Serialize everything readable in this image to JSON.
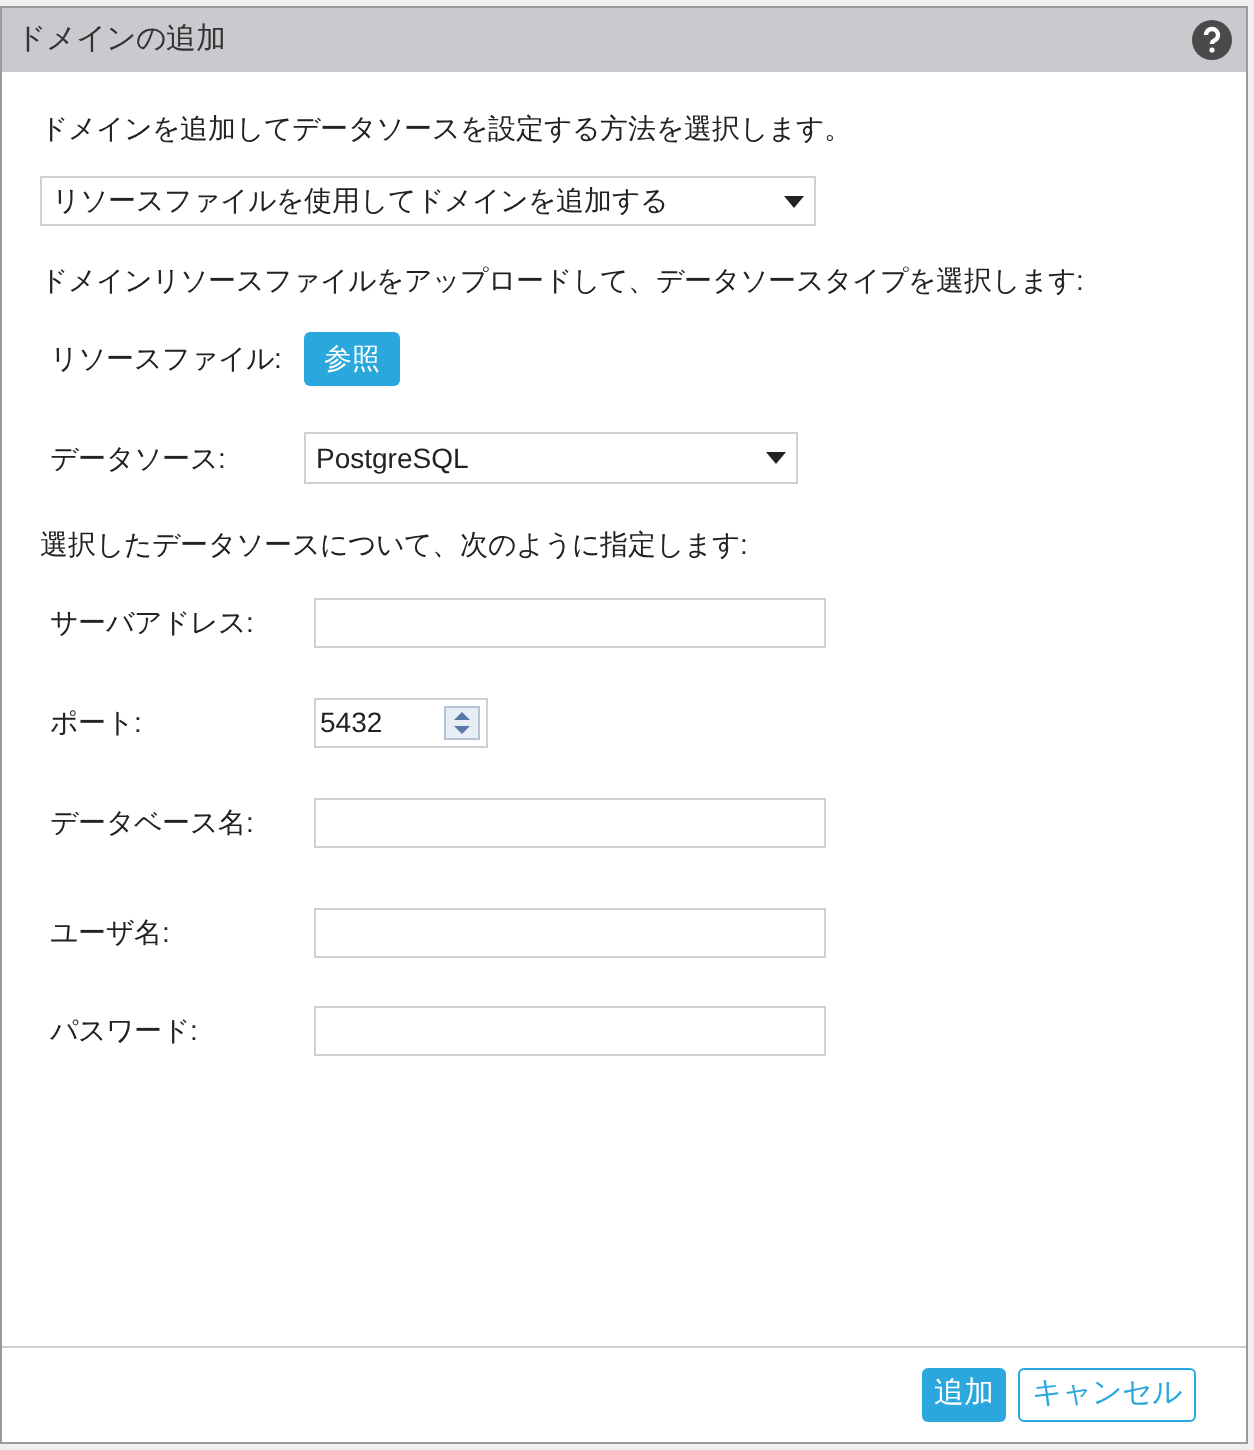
{
  "dialog": {
    "title": "ドメインの追加"
  },
  "intro": "ドメインを追加してデータソースを設定する方法を選択します。",
  "method_select": {
    "value": "リソースファイルを使用してドメインを追加する"
  },
  "upload_hint": "ドメインリソースファイルをアップロードして、データソースタイプを選択します:",
  "resource_file": {
    "label": "リソースファイル:",
    "button": "参照"
  },
  "data_source": {
    "label": "データソース:",
    "value": "PostgreSQL"
  },
  "spec_hint": "選択したデータソースについて、次のように指定します:",
  "fields": [
    {
      "label": "サーバアドレス:",
      "kind": "text"
    },
    {
      "label": "ポート:",
      "kind": "number",
      "value": "5432"
    },
    {
      "label": "データベース名:",
      "kind": "text"
    },
    {
      "label": "ユーザ名:",
      "kind": "text"
    },
    {
      "label": "パスワード:",
      "kind": "text"
    }
  ],
  "buttons": [
    {
      "label": "追加",
      "kind": "primary"
    },
    {
      "label": "キャンセル",
      "kind": "secondary"
    }
  ]
}
